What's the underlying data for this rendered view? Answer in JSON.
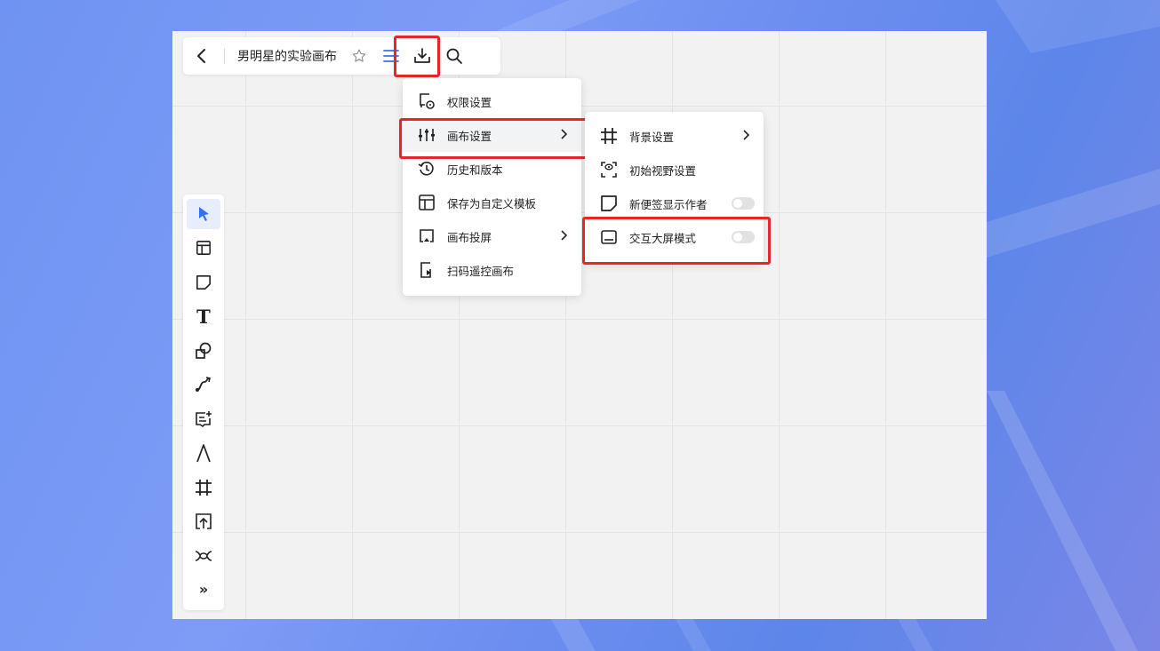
{
  "topbar": {
    "title": "男明星的实验画布",
    "icons": [
      "back-chevron-icon",
      "star-icon",
      "menu-icon",
      "download-icon",
      "search-icon"
    ]
  },
  "main_menu": {
    "items": [
      {
        "label": "权限设置",
        "icon": "permission-icon"
      },
      {
        "label": "画布设置",
        "icon": "sliders-icon",
        "has_submenu": true,
        "active": true
      },
      {
        "label": "历史和版本",
        "icon": "history-icon"
      },
      {
        "label": "保存为自定义模板",
        "icon": "template-icon"
      },
      {
        "label": "画布投屏",
        "icon": "cast-icon",
        "has_submenu": true
      },
      {
        "label": "扫码遥控画布",
        "icon": "scan-remote-icon"
      }
    ]
  },
  "sub_menu": {
    "items": [
      {
        "label": "背景设置",
        "icon": "grid-icon",
        "has_submenu": true
      },
      {
        "label": "初始视野设置",
        "icon": "view-icon"
      },
      {
        "label": "新便签显示作者",
        "icon": "sticky-note-icon",
        "toggle": false
      },
      {
        "label": "交互大屏模式",
        "icon": "screen-icon",
        "toggle": false
      }
    ]
  },
  "toolbar": {
    "tools": [
      "select-cursor-icon",
      "frame-layout-icon",
      "sticky-note-icon",
      "text-icon",
      "shape-icon",
      "connector-icon",
      "comment-icon",
      "pen-icon",
      "crop-frame-icon",
      "upload-icon",
      "mindmap-icon",
      "more-icon"
    ],
    "more_label": "»",
    "text_label": "T"
  },
  "colors": {
    "accent": "#3370ff",
    "highlight": "#e8262a",
    "canvas": "#f2f2f2"
  }
}
